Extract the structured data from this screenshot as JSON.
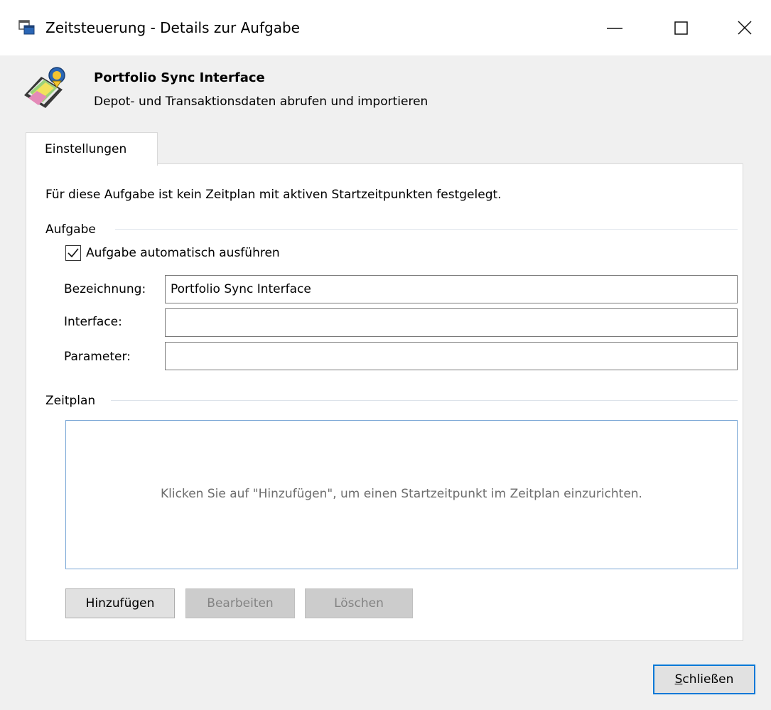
{
  "window": {
    "title": "Zeitsteuerung - Details zur Aufgabe",
    "app_icon": "task-scheduler-icon",
    "controls": [
      "minimize-icon",
      "maximize-icon",
      "close-icon"
    ]
  },
  "header": {
    "logo": "portfolio-sync-icon",
    "title": "Portfolio Sync Interface",
    "description": "Depot- und Transaktionsdaten abrufen und importieren"
  },
  "tabs": [
    {
      "label": "Einstellungen",
      "selected": true
    }
  ],
  "settings": {
    "info_text": "Für diese Aufgabe ist kein Zeitplan mit aktiven Startzeitpunkten festgelegt.",
    "task_group": {
      "label": "Aufgabe",
      "auto_run": {
        "label": "Aufgabe automatisch ausführen",
        "checked": true
      },
      "fields": {
        "bezeichnung": {
          "label": "Bezeichnung:",
          "value": "Portfolio Sync Interface"
        },
        "interface": {
          "label": "Interface:",
          "value": ""
        },
        "parameter": {
          "label": "Parameter:",
          "value": ""
        }
      }
    },
    "schedule_group": {
      "label": "Zeitplan",
      "empty_hint": "Klicken Sie auf \"Hinzufügen\", um einen Startzeitpunkt im Zeitplan einzurichten.",
      "buttons": {
        "add": {
          "label": "Hinzufügen",
          "enabled": true
        },
        "edit": {
          "label": "Bearbeiten",
          "enabled": false
        },
        "delete": {
          "label": "Löschen",
          "enabled": false
        }
      }
    }
  },
  "footer": {
    "close_button": {
      "label_prefix": "",
      "mnemonic": "S",
      "label_rest": "chließen"
    }
  },
  "colors": {
    "accent_focus": "#0078d7",
    "list_border": "#7aa7d6",
    "hint_text": "#6d6d6d",
    "disabled_text": "#838383"
  }
}
